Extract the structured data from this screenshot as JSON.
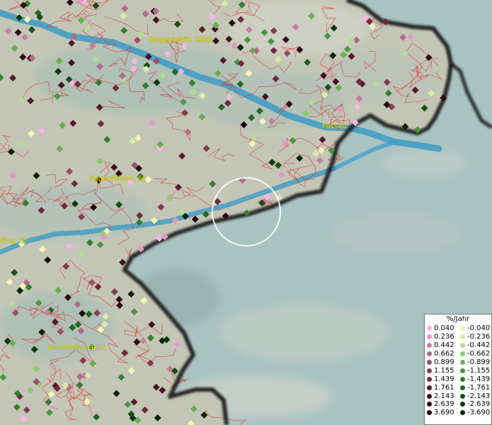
{
  "map": {
    "colors": {
      "land": "#c4c7b8",
      "land_shade": "#9eb8b2",
      "austria": "#a9c3c1",
      "river": "#3d9bc4",
      "district_line": "#e03030",
      "border": "#151515",
      "label": "#e6e600"
    },
    "labels": [
      {
        "name": "deggendorf-label",
        "text": "Deggendorf, GKSt"
      },
      {
        "name": "passau-label",
        "text": "Passau"
      },
      {
        "name": "eggenfelden-label",
        "text": "Eggenfelden, St"
      },
      {
        "name": "dingolfing-label",
        "text": "lfing, St"
      },
      {
        "name": "traunstein-label",
        "text": "Traunstein, GKSt"
      }
    ]
  },
  "legend": {
    "title": "%/Jahr",
    "positive": {
      "values": [
        "0.040",
        "0.236",
        "0.442",
        "0.662",
        "0.899",
        "1.155",
        "1.439",
        "1.761",
        "2.143",
        "2.639",
        "3.690"
      ],
      "colors": [
        "#f6b6e8",
        "#df9cc6",
        "#c67fa2",
        "#b06a8a",
        "#9a4f6a",
        "#833c52",
        "#6e2a3e",
        "#5a1a2c",
        "#44101e",
        "#2f0812",
        "#1c0006"
      ]
    },
    "negative": {
      "values": [
        "-0.040",
        "-0.236",
        "-0.442",
        "-0.662",
        "-0.899",
        "-1.155",
        "-1.439",
        "-1.761",
        "-2.143",
        "-2.639",
        "-3.690"
      ],
      "colors": [
        "#f2f6b0",
        "#d6ecaa",
        "#b4dc90",
        "#8ec870",
        "#6aae52",
        "#4d9640",
        "#367e30",
        "#246622",
        "#174e16",
        "#0c380c",
        "#042404"
      ]
    }
  }
}
